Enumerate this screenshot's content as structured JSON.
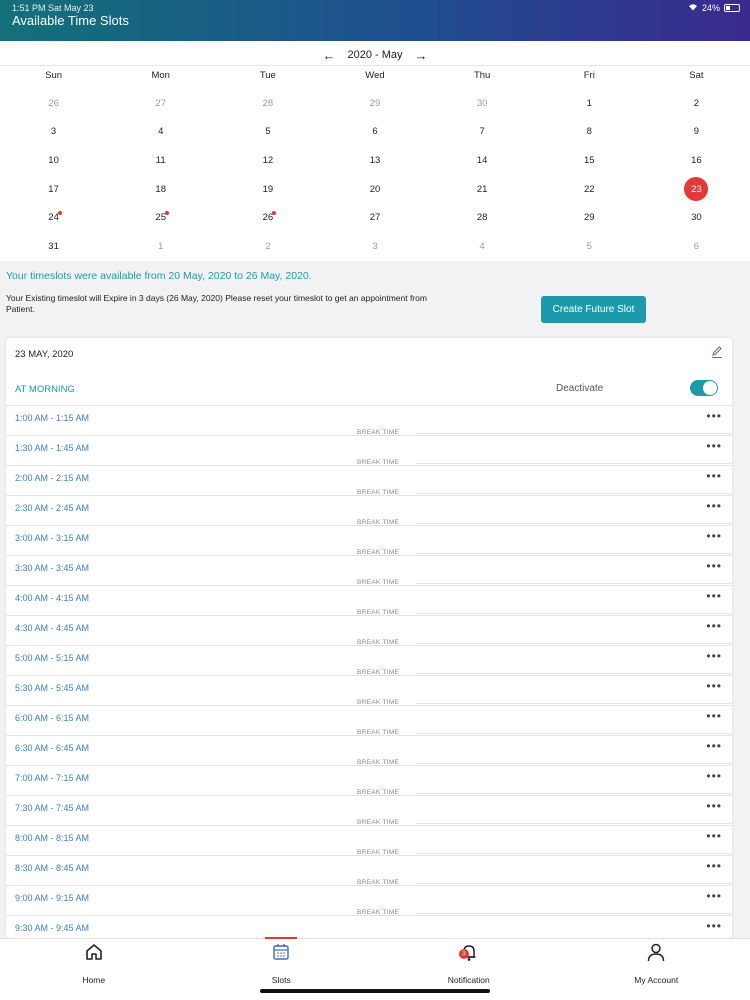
{
  "status": {
    "time": "1:51 PM   Sat May 23",
    "battery": "24%"
  },
  "header": {
    "title": "Available Time Slots"
  },
  "calendar": {
    "month_label": "2020 - May",
    "weekdays": [
      "Sun",
      "Mon",
      "Tue",
      "Wed",
      "Thu",
      "Fri",
      "Sat"
    ],
    "days": [
      {
        "d": "26",
        "m": true
      },
      {
        "d": "27",
        "m": true
      },
      {
        "d": "28",
        "m": true
      },
      {
        "d": "29",
        "m": true
      },
      {
        "d": "30",
        "m": true
      },
      {
        "d": "1"
      },
      {
        "d": "2"
      },
      {
        "d": "3"
      },
      {
        "d": "4"
      },
      {
        "d": "5"
      },
      {
        "d": "6"
      },
      {
        "d": "7"
      },
      {
        "d": "8"
      },
      {
        "d": "9"
      },
      {
        "d": "10"
      },
      {
        "d": "11"
      },
      {
        "d": "12"
      },
      {
        "d": "13"
      },
      {
        "d": "14"
      },
      {
        "d": "15"
      },
      {
        "d": "16"
      },
      {
        "d": "17"
      },
      {
        "d": "18"
      },
      {
        "d": "19"
      },
      {
        "d": "20"
      },
      {
        "d": "21"
      },
      {
        "d": "22"
      },
      {
        "d": "23",
        "sel": true
      },
      {
        "d": "24",
        "dot": true
      },
      {
        "d": "25",
        "dot": true
      },
      {
        "d": "26",
        "dot": true
      },
      {
        "d": "27"
      },
      {
        "d": "28"
      },
      {
        "d": "29"
      },
      {
        "d": "30"
      },
      {
        "d": "31"
      },
      {
        "d": "1",
        "m": true
      },
      {
        "d": "2",
        "m": true
      },
      {
        "d": "3",
        "m": true
      },
      {
        "d": "4",
        "m": true
      },
      {
        "d": "5",
        "m": true
      },
      {
        "d": "6",
        "m": true
      }
    ]
  },
  "info": {
    "available": "Your timeslots were available from 20 May, 2020 to 26 May, 2020.",
    "expire": "Your Existing timeslot will Expire in 3 days (26 May, 2020) Please reset your timeslot to get an appointment from Patient.",
    "create_button": "Create Future Slot"
  },
  "card": {
    "date": "23 MAY, 2020",
    "session": "AT MORNING",
    "deactivate_label": "Deactivate",
    "toggle_on": true,
    "break_label": "BREAK TIME",
    "more_label": "•••",
    "slots": [
      "1:00 AM - 1:15 AM",
      "1:30 AM - 1:45 AM",
      "2:00 AM - 2:15 AM",
      "2:30 AM - 2:45 AM",
      "3:00 AM - 3:15 AM",
      "3:30 AM - 3:45 AM",
      "4:00 AM - 4:15 AM",
      "4:30 AM - 4:45 AM",
      "5:00 AM - 5:15 AM",
      "5:30 AM - 5:45 AM",
      "6:00 AM - 6:15 AM",
      "6:30 AM - 6:45 AM",
      "7:00 AM - 7:15 AM",
      "7:30 AM - 7:45 AM",
      "8:00 AM - 8:15 AM",
      "8:30 AM - 8:45 AM",
      "9:00 AM - 9:15 AM",
      "9:30 AM - 9:45 AM"
    ]
  },
  "nav": {
    "items": [
      {
        "label": "Home",
        "icon": "home-icon"
      },
      {
        "label": "Slots",
        "icon": "calendar-icon",
        "active": true
      },
      {
        "label": "Notification",
        "icon": "bell-icon",
        "badge": "3"
      },
      {
        "label": "My Account",
        "icon": "user-icon"
      }
    ]
  },
  "colors": {
    "accent": "#1a9aab",
    "link": "#1a9bb5",
    "alert": "#e53935"
  }
}
